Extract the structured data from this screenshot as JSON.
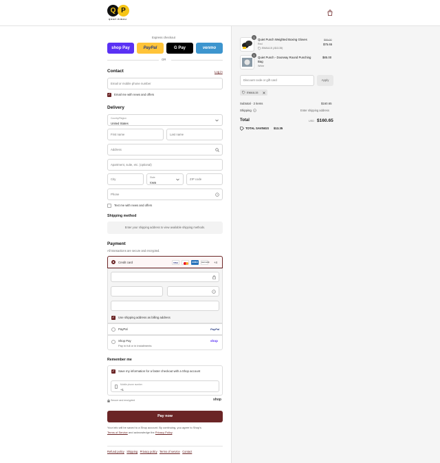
{
  "header": {
    "logo_letters": [
      "Q",
      "P"
    ],
    "logo_text": "QUIET PUNCH",
    "cart_icon": "shopping-bag-icon"
  },
  "express": {
    "title": "Express checkout",
    "shop_pay": "shop Pay",
    "paypal": "PayPal",
    "gpay": "G Pay",
    "venmo": "venmo",
    "or": "OR"
  },
  "contact": {
    "title": "Contact",
    "login": "Log in",
    "phone_placeholder": "Email or mobile phone number",
    "news": "Email me with news and offers"
  },
  "delivery": {
    "title": "Delivery",
    "country_label": "Country/Region",
    "country": "United States",
    "first": "First name",
    "last": "Last name",
    "address": "Address",
    "apt": "Apartment, suite, etc. (optional)",
    "city": "City",
    "state_label": "State",
    "state": "Iowa",
    "zip": "ZIP code",
    "phone": "Phone",
    "text_me": "Text me with news and offers"
  },
  "shipping": {
    "title": "Shipping method",
    "note": "Enter your shipping address to view available shipping methods."
  },
  "payment": {
    "title": "Payment",
    "secure": "All transactions are secure and encrypted.",
    "credit_card": "Credit card",
    "more_cards": "+4",
    "cards": [
      "VISA",
      "MC",
      "AMEX",
      "DISCOVER"
    ],
    "billing": "Use shipping address as billing address",
    "paypal": "PayPal",
    "paypal_logo": "PayPal",
    "shop_pay": "Shop Pay",
    "shop_pay_sub": "Pay in full or in installments",
    "shop_logo": "shop"
  },
  "remember": {
    "title": "Remember me",
    "save": "Save my information for a faster checkout with a Shop account",
    "mobile_label": "Mobile phone number",
    "mobile_value": "+1",
    "secure": "Secure and encrypted",
    "shop": "shop"
  },
  "pay_now": "Pay now",
  "legal": {
    "text1": "Your info will be saved to a Shop account. By continuing, you agree to Shop's",
    "terms_service": "Terms of Service",
    "text2": "and acknowledge the",
    "privacy": "Privacy Policy",
    "end": "."
  },
  "footer": [
    "Refund policy",
    "Shipping",
    "Privacy policy",
    "Terms of service",
    "Contact"
  ],
  "cart": {
    "items": [
      {
        "qty": "1",
        "name": "Quiet Punch Weighted Boxing Gloves",
        "variant": "Red",
        "discount": "EMAIL15 (-$13.35)",
        "old_price": "$89.00",
        "price": "$75.65"
      },
      {
        "qty": "1",
        "name": "Quiet Punch - Doorway Round Punching Bag",
        "variant": "White",
        "price": "$85.00"
      }
    ],
    "discount_placeholder": "Discount code or gift card",
    "apply": "Apply",
    "code": "EMAIL15",
    "subtotal_label": "Subtotal · 2 items",
    "subtotal": "$160.65",
    "shipping_label": "Shipping",
    "shipping_value": "Enter shipping address",
    "total_label": "Total",
    "currency": "USD",
    "total": "$160.65",
    "savings_label": "TOTAL SAVINGS",
    "savings": "$13.35"
  }
}
